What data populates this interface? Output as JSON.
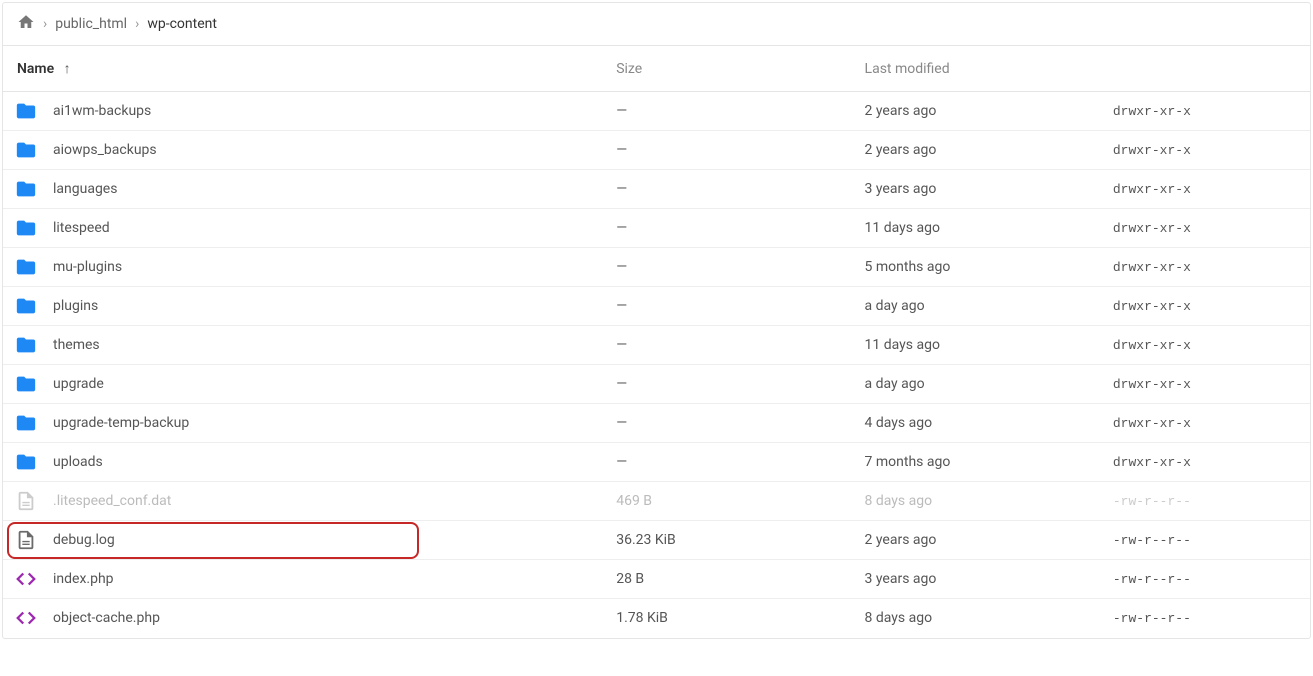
{
  "breadcrumb": {
    "items": [
      "public_html",
      "wp-content"
    ]
  },
  "columns": {
    "name": "Name",
    "size": "Size",
    "modified": "Last modified"
  },
  "rows": [
    {
      "icon": "folder",
      "name": "ai1wm-backups",
      "size": "—",
      "modified": "2 years ago",
      "perms": "drwxr-xr-x",
      "dim": false,
      "highlight": false
    },
    {
      "icon": "folder",
      "name": "aiowps_backups",
      "size": "—",
      "modified": "2 years ago",
      "perms": "drwxr-xr-x",
      "dim": false,
      "highlight": false
    },
    {
      "icon": "folder",
      "name": "languages",
      "size": "—",
      "modified": "3 years ago",
      "perms": "drwxr-xr-x",
      "dim": false,
      "highlight": false
    },
    {
      "icon": "folder",
      "name": "litespeed",
      "size": "—",
      "modified": "11 days ago",
      "perms": "drwxr-xr-x",
      "dim": false,
      "highlight": false
    },
    {
      "icon": "folder",
      "name": "mu-plugins",
      "size": "—",
      "modified": "5 months ago",
      "perms": "drwxr-xr-x",
      "dim": false,
      "highlight": false
    },
    {
      "icon": "folder",
      "name": "plugins",
      "size": "—",
      "modified": "a day ago",
      "perms": "drwxr-xr-x",
      "dim": false,
      "highlight": false
    },
    {
      "icon": "folder",
      "name": "themes",
      "size": "—",
      "modified": "11 days ago",
      "perms": "drwxr-xr-x",
      "dim": false,
      "highlight": false
    },
    {
      "icon": "folder",
      "name": "upgrade",
      "size": "—",
      "modified": "a day ago",
      "perms": "drwxr-xr-x",
      "dim": false,
      "highlight": false
    },
    {
      "icon": "folder",
      "name": "upgrade-temp-backup",
      "size": "—",
      "modified": "4 days ago",
      "perms": "drwxr-xr-x",
      "dim": false,
      "highlight": false
    },
    {
      "icon": "folder",
      "name": "uploads",
      "size": "—",
      "modified": "7 months ago",
      "perms": "drwxr-xr-x",
      "dim": false,
      "highlight": false
    },
    {
      "icon": "file",
      "name": ".litespeed_conf.dat",
      "size": "469 B",
      "modified": "8 days ago",
      "perms": "-rw-r--r--",
      "dim": true,
      "highlight": false
    },
    {
      "icon": "file",
      "name": "debug.log",
      "size": "36.23 KiB",
      "modified": "2 years ago",
      "perms": "-rw-r--r--",
      "dim": false,
      "highlight": true
    },
    {
      "icon": "code",
      "name": "index.php",
      "size": "28 B",
      "modified": "3 years ago",
      "perms": "-rw-r--r--",
      "dim": false,
      "highlight": false
    },
    {
      "icon": "code",
      "name": "object-cache.php",
      "size": "1.78 KiB",
      "modified": "8 days ago",
      "perms": "-rw-r--r--",
      "dim": false,
      "highlight": false
    }
  ]
}
